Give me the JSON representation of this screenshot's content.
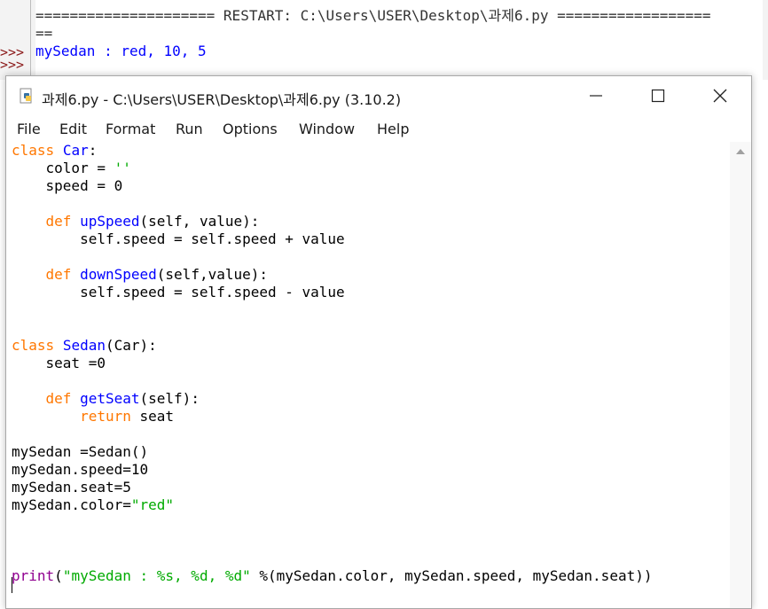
{
  "shell": {
    "restart_line": "===================== RESTART: C:\\Users\\USER\\Desktop\\과제6.py ==================",
    "restart_cont": "==",
    "prompt": ">>>",
    "output": "mySedan : red, 10, 5"
  },
  "editor": {
    "title": "과제6.py - C:\\Users\\USER\\Desktop\\과제6.py (3.10.2)",
    "minimize_icon": "minimize-icon",
    "maximize_icon": "maximize-icon",
    "close_icon": "close-icon",
    "menu": [
      "File",
      "Edit",
      "Format",
      "Run",
      "Options",
      "Window",
      "Help"
    ],
    "code": [
      "class Car:",
      "    color = ''",
      "    speed = 0",
      "",
      "    def upSpeed(self, value):",
      "        self.speed = self.speed + value",
      "",
      "    def downSpeed(self,value):",
      "        self.speed = self.speed - value",
      "",
      "",
      "class Sedan(Car):",
      "    seat =0",
      "",
      "    def getSeat(self):",
      "        return seat",
      "",
      "mySedan =Sedan()",
      "mySedan.speed=10",
      "mySedan.seat=5",
      "mySedan.color=\"red\"",
      "",
      "",
      "",
      "print(\"mySedan : %s, %d, %d\" %(mySedan.color, mySedan.speed, mySedan.seat))"
    ]
  },
  "colors": {
    "keyword": "#ff7700",
    "definition": "#0000ff",
    "string": "#00aa00",
    "builtin": "#900090",
    "shell_output": "#0000ff",
    "prompt": "#8b1a1a"
  }
}
